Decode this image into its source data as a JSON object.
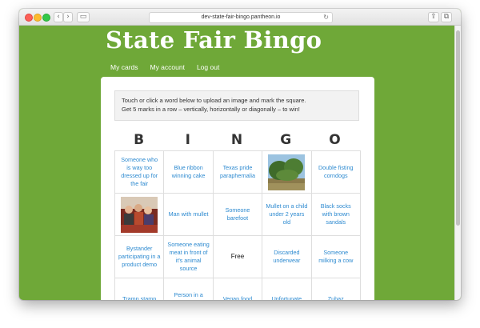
{
  "browser": {
    "url": "dev-state-fair-bingo.pantheon.io"
  },
  "site": {
    "title": "State Fair Bingo",
    "nav": [
      "My cards",
      "My account",
      "Log out"
    ]
  },
  "instructions": {
    "line1": "Touch or click a word below to upload an image and mark the square.",
    "line2": "Get 5 marks in a row – vertically, horizontally or diagonally – to win!"
  },
  "bingo": {
    "letters": [
      "B",
      "I",
      "N",
      "G",
      "O"
    ],
    "cells": [
      "Someone who is way too dressed up for the fair",
      "Blue ribbon winning cake",
      "Texas pride paraphernalia",
      "",
      "Double fisting corndogs",
      "",
      "Man with mullet",
      "Someone barefoot",
      "Mullet on a child under 2 years old",
      "Black socks with brown sandals",
      "Bystander participating in a product demo",
      "Someone eating meat in front of it's animal source",
      "Free",
      "Discarded underwear",
      "Someone milking a cow",
      "Tramp stamp",
      "Person in a mascot",
      "Vegan food",
      "Unfortunate",
      "Zubaz"
    ],
    "free_label": "Free",
    "image_cells": {
      "landscape": "photo-trees-field",
      "people": "photo-group-of-people"
    }
  },
  "colors": {
    "page_green": "#6fa838",
    "link_blue": "#2d8ad0"
  }
}
